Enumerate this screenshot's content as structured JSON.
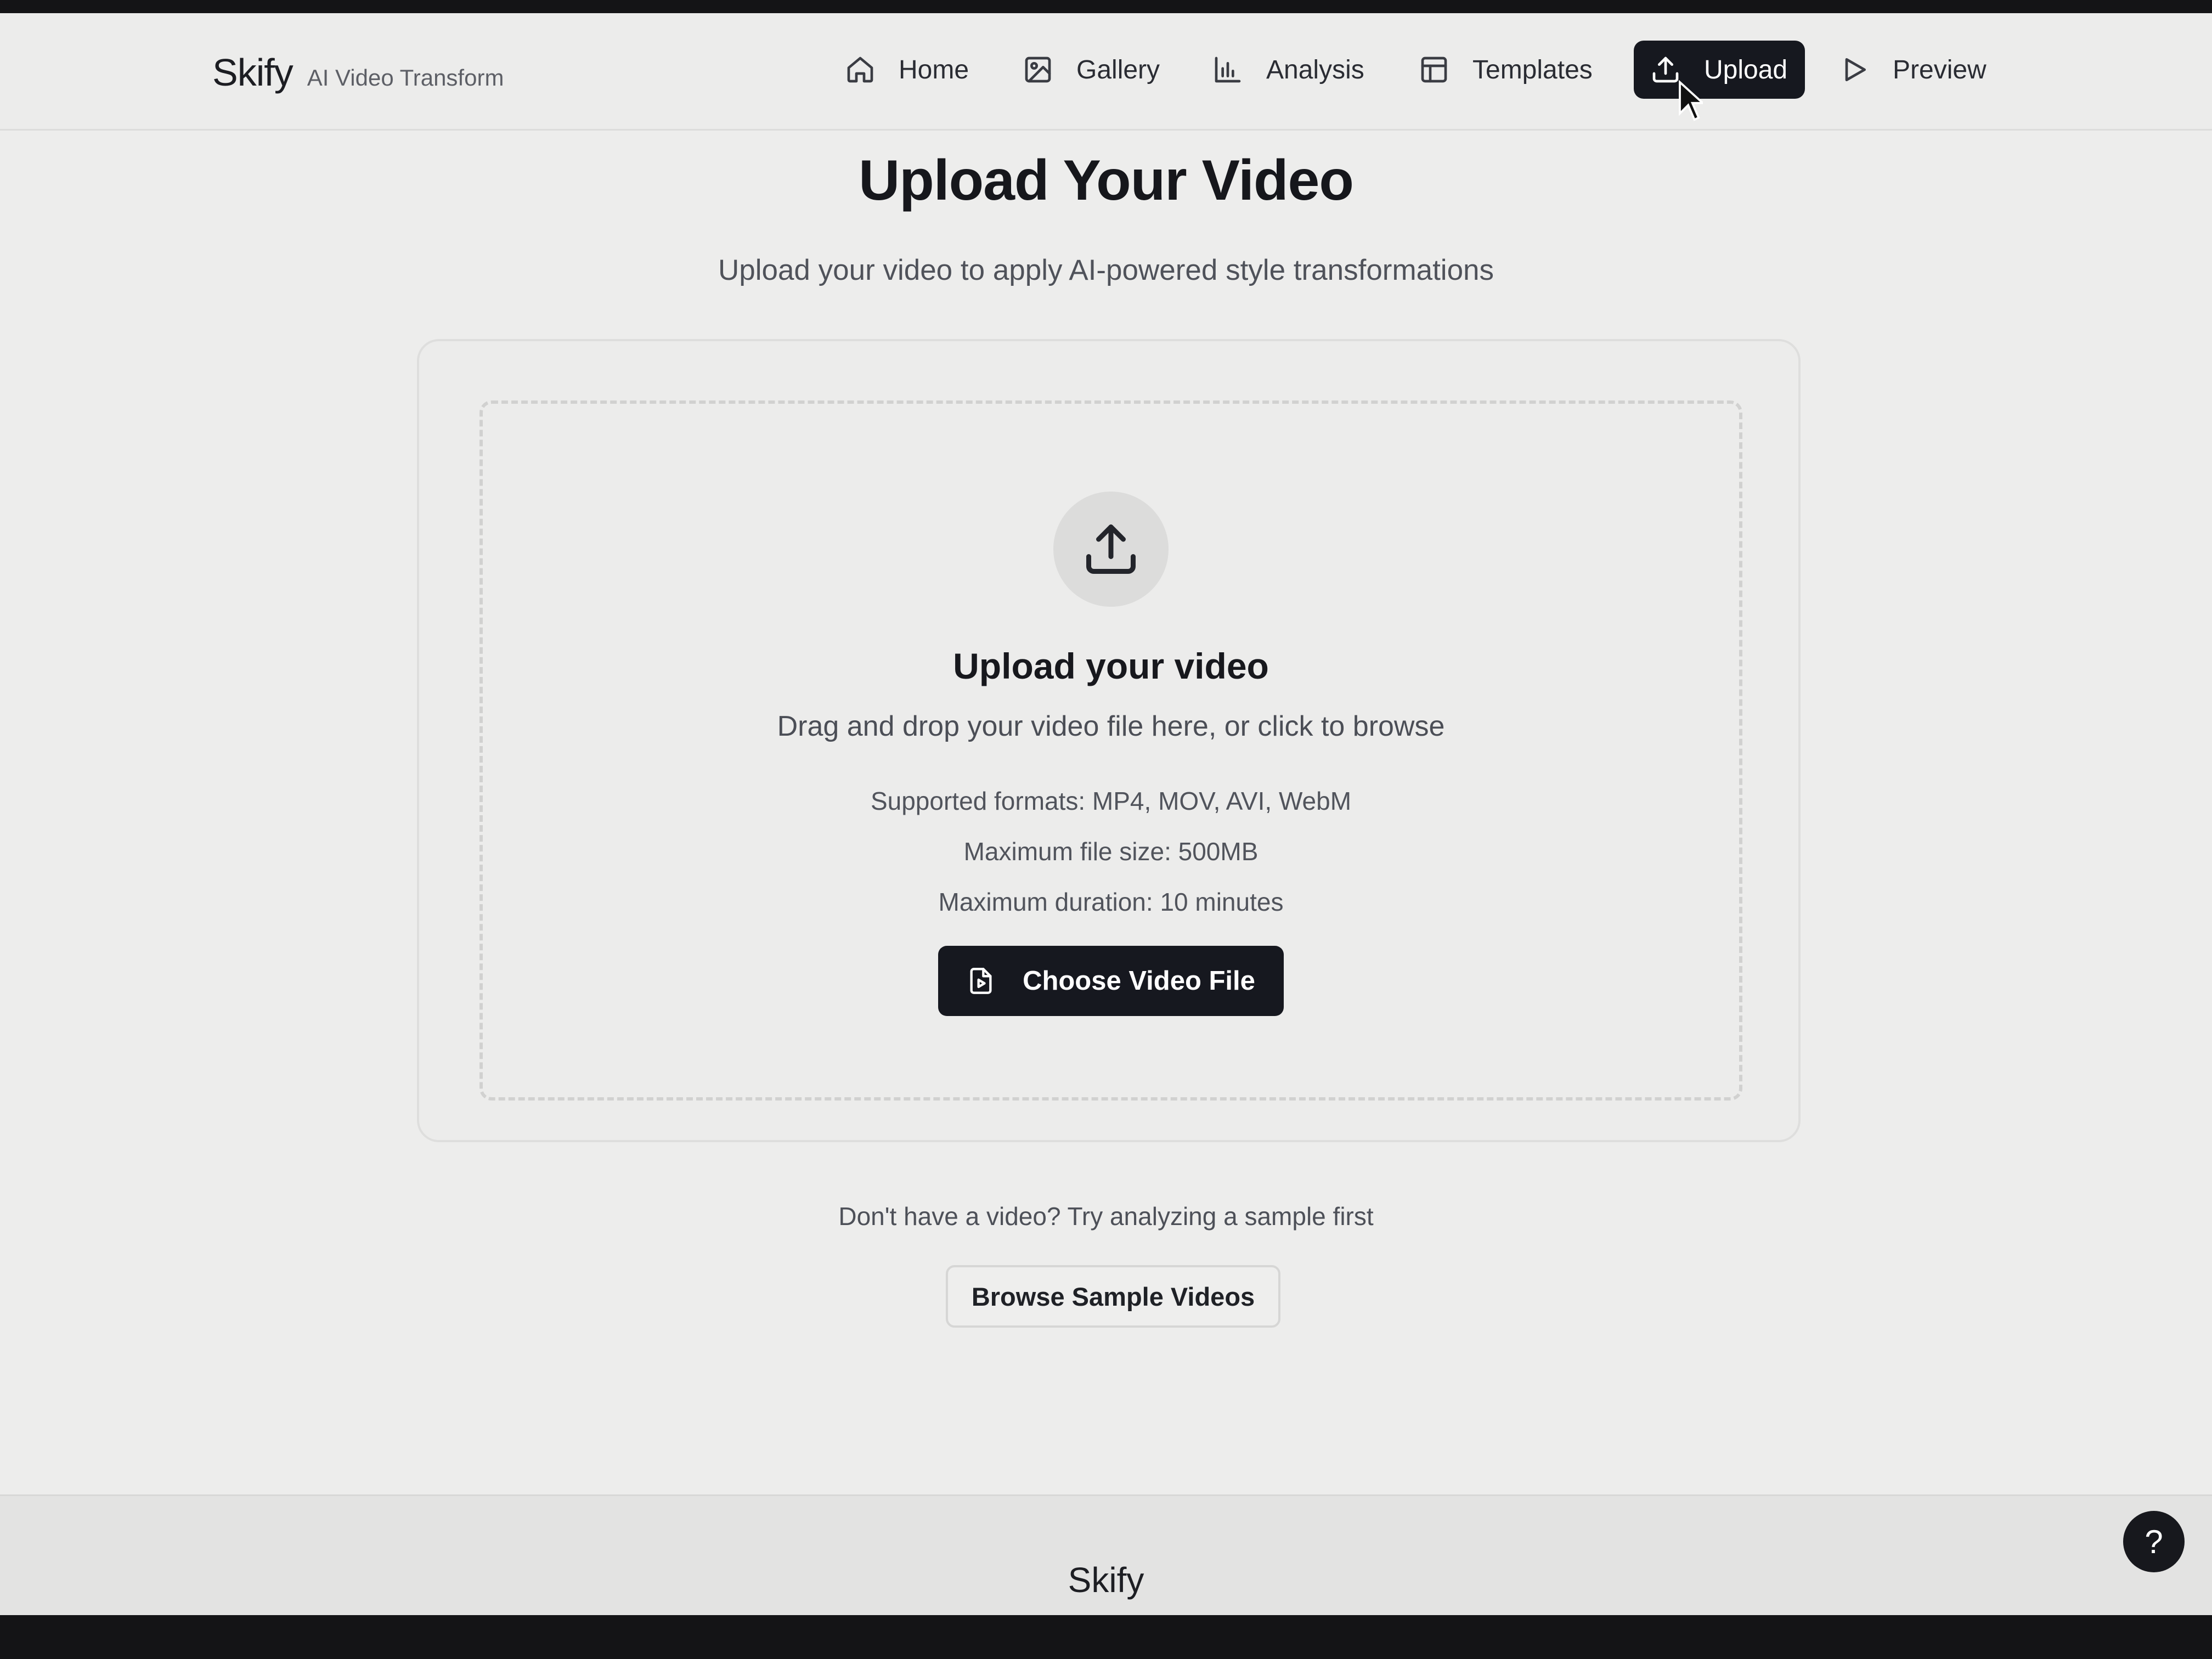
{
  "header": {
    "brand_name": "Skify",
    "brand_tagline": "AI Video Transform",
    "nav": [
      {
        "label": "Home",
        "icon": "home-icon"
      },
      {
        "label": "Gallery",
        "icon": "image-icon"
      },
      {
        "label": "Analysis",
        "icon": "bar-chart-icon"
      },
      {
        "label": "Templates",
        "icon": "layout-icon"
      },
      {
        "label": "Upload",
        "icon": "upload-icon",
        "active": true
      },
      {
        "label": "Preview",
        "icon": "play-icon"
      }
    ]
  },
  "main": {
    "title": "Upload Your Video",
    "subtitle": "Upload your video to apply AI-powered style transformations"
  },
  "dropzone": {
    "icon": "upload-icon",
    "title": "Upload your video",
    "description": "Drag and drop your video file here, or click to browse",
    "formats": "Supported formats: MP4, MOV, AVI, WebM",
    "max_size": "Maximum file size: 500MB",
    "max_duration": "Maximum duration: 10 minutes",
    "choose_button": "Choose Video File"
  },
  "sample": {
    "text": "Don't have a video? Try analyzing a sample first",
    "button": "Browse Sample Videos"
  },
  "footer": {
    "brand": "Skify"
  },
  "help": {
    "label": "?"
  },
  "colors": {
    "background": "#ededec",
    "primary_button": "#16181f",
    "text_primary": "#16171c",
    "text_muted": "#4f525a"
  }
}
